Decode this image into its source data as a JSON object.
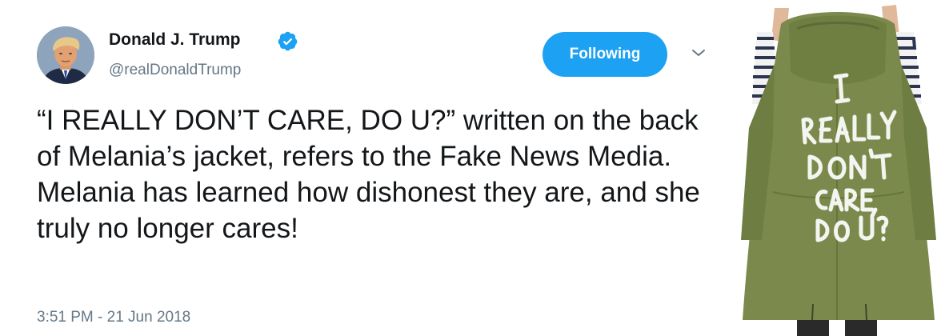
{
  "tweet": {
    "author": {
      "name": "Donald J. Trump",
      "handle": "@realDonaldTrump",
      "verified": true,
      "avatar_icon": "profile-photo"
    },
    "follow_button": {
      "label": "Following",
      "color": "#1da1f2"
    },
    "menu_icon": "chevron-down-icon",
    "text": "“I REALLY DON’T CARE, DO U?” written on the back of Melania’s jacket, refers to the Fake News Media. Melania has learned how dishonest they are, and she truly no longer cares!",
    "timestamp": "3:51 PM - 21 Jun 2018",
    "media": {
      "type": "photo",
      "jacket_writing": "I REALLY DON'T CARE, DO U?",
      "jacket_color": "#7b8a4c"
    }
  },
  "colors": {
    "text_primary": "#14171a",
    "text_secondary": "#657786",
    "verified_blue": "#1da1f2"
  }
}
